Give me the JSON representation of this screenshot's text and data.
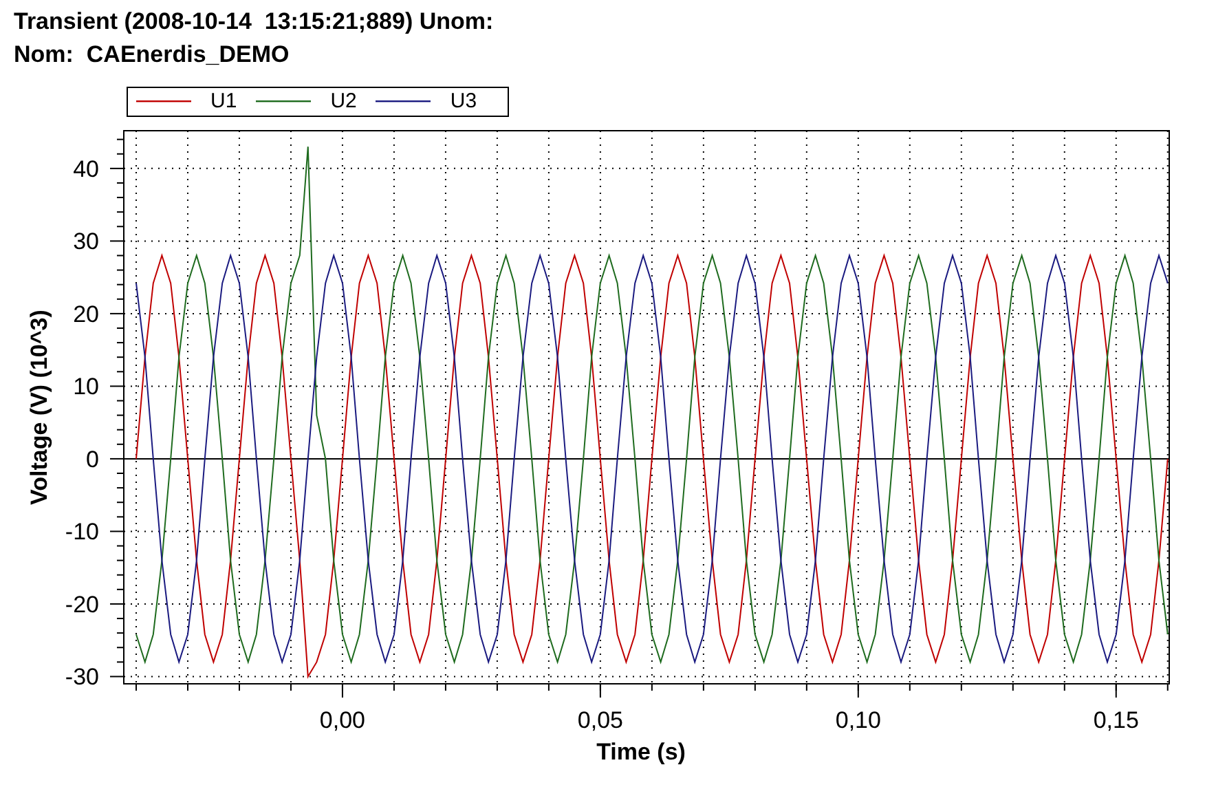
{
  "header": {
    "title": "Transient (2008-10-14  13:15:21;889) Unom:",
    "subtitle": "Nom:  CAEnerdis_DEMO"
  },
  "chart": {
    "chart_data": {
      "type": "line",
      "grid": true,
      "xlabel": "Time (s)",
      "ylabel": "Voltage (V) (10^3)",
      "xlim": [
        -0.0424,
        0.1603
      ],
      "ylim": [
        -31,
        45.2
      ],
      "xticks": [
        {
          "value": 0,
          "label": "0,00"
        },
        {
          "value": 0.05,
          "label": "0,05"
        },
        {
          "value": 0.1,
          "label": "0,10"
        },
        {
          "value": 0.15,
          "label": "0,15"
        }
      ],
      "yticks": [
        -30,
        -20,
        -10,
        0,
        10,
        20,
        30,
        40
      ],
      "x": [
        -0.04,
        -0.0383,
        -0.0367,
        -0.035,
        -0.0333,
        -0.0317,
        -0.03,
        -0.0283,
        -0.0267,
        -0.025,
        -0.0233,
        -0.0217,
        -0.02,
        -0.0183,
        -0.0167,
        -0.015,
        -0.0133,
        -0.0117,
        -0.01,
        -0.0083,
        -0.0067,
        -0.005,
        -0.0033,
        -0.0017,
        0,
        0.0017,
        0.0033,
        0.005,
        0.0067,
        0.0083,
        0.01,
        0.0117,
        0.0133,
        0.015,
        0.0167,
        0.0183,
        0.02,
        0.0217,
        0.0233,
        0.025,
        0.0267,
        0.0283,
        0.03,
        0.0317,
        0.0333,
        0.035,
        0.0367,
        0.0383,
        0.04,
        0.0417,
        0.0433,
        0.045,
        0.0467,
        0.0483,
        0.05,
        0.0517,
        0.0533,
        0.055,
        0.0567,
        0.0583,
        0.06,
        0.0617,
        0.0633,
        0.065,
        0.0667,
        0.0683,
        0.07,
        0.0717,
        0.0733,
        0.075,
        0.0767,
        0.0783,
        0.08,
        0.0817,
        0.0833,
        0.085,
        0.0867,
        0.0883,
        0.09,
        0.0917,
        0.0933,
        0.095,
        0.0967,
        0.0983,
        0.1,
        0.1017,
        0.1033,
        0.105,
        0.1067,
        0.1083,
        0.11,
        0.1117,
        0.1133,
        0.115,
        0.1167,
        0.1183,
        0.12,
        0.1217,
        0.1233,
        0.125,
        0.1267,
        0.1283,
        0.13,
        0.1317,
        0.1333,
        0.135,
        0.1367,
        0.1383,
        0.14,
        0.1417,
        0.1433,
        0.145,
        0.1467,
        0.1483,
        0.15,
        0.1517,
        0.1533,
        0.155,
        0.1567,
        0.1583,
        0.16
      ],
      "series": [
        {
          "name": "U1",
          "color": "#c00000",
          "values": [
            0,
            14,
            24.2,
            28,
            24.2,
            14,
            0,
            -14,
            -24.2,
            -28,
            -24.2,
            -14,
            0,
            14,
            24.2,
            28,
            24.2,
            14,
            0,
            -14,
            -30,
            -28,
            -24.2,
            -14,
            0,
            14,
            24.2,
            28,
            24.2,
            14,
            0,
            -14,
            -24.2,
            -28,
            -24.2,
            -14,
            0,
            14,
            24.2,
            28,
            24.2,
            14,
            0,
            -14,
            -24.2,
            -28,
            -24.2,
            -14,
            0,
            14,
            24.2,
            28,
            24.2,
            14,
            0,
            -14,
            -24.2,
            -28,
            -24.2,
            -14,
            0,
            14,
            24.2,
            28,
            24.2,
            14,
            0,
            -14,
            -24.2,
            -28,
            -24.2,
            -14,
            0,
            14,
            24.2,
            28,
            24.2,
            14,
            0,
            -14,
            -24.2,
            -28,
            -24.2,
            -14,
            0,
            14,
            24.2,
            28,
            24.2,
            14,
            0,
            -14,
            -24.2,
            -28,
            -24.2,
            -14,
            0,
            14,
            24.2,
            28,
            24.2,
            14,
            0,
            -14,
            -24.2,
            -28,
            -24.2,
            -14,
            0,
            14,
            24.2,
            28,
            24.2,
            14,
            0,
            -14,
            -24.2,
            -28,
            -24.2,
            -14,
            0
          ]
        },
        {
          "name": "U2",
          "color": "#1e6b1e",
          "values": [
            -24.2,
            -28,
            -24.2,
            -14,
            0,
            14,
            24.2,
            28,
            24.2,
            14,
            0,
            -14,
            -24.2,
            -28,
            -24.2,
            -14,
            0,
            14,
            24.2,
            28,
            43,
            6,
            0,
            -14,
            -24.2,
            -28,
            -24.2,
            -14,
            0,
            14,
            24.2,
            28,
            24.2,
            14,
            0,
            -14,
            -24.2,
            -28,
            -24.2,
            -14,
            0,
            14,
            24.2,
            28,
            24.2,
            14,
            0,
            -14,
            -24.2,
            -28,
            -24.2,
            -14,
            0,
            14,
            24.2,
            28,
            24.2,
            14,
            0,
            -14,
            -24.2,
            -28,
            -24.2,
            -14,
            0,
            14,
            24.2,
            28,
            24.2,
            14,
            0,
            -14,
            -24.2,
            -28,
            -24.2,
            -14,
            0,
            14,
            24.2,
            28,
            24.2,
            14,
            0,
            -14,
            -24.2,
            -28,
            -24.2,
            -14,
            0,
            14,
            24.2,
            28,
            24.2,
            14,
            0,
            -14,
            -24.2,
            -28,
            -24.2,
            -14,
            0,
            14,
            24.2,
            28,
            24.2,
            14,
            0,
            -14,
            -24.2,
            -28,
            -24.2,
            -14,
            0,
            14,
            24.2,
            28,
            24.2,
            14,
            0,
            -14,
            -24.2
          ]
        },
        {
          "name": "U3",
          "color": "#1a1a80",
          "values": [
            24.2,
            14,
            0,
            -14,
            -24.2,
            -28,
            -24.2,
            -14,
            0,
            14,
            24.2,
            28,
            24.2,
            14,
            0,
            -14,
            -24.2,
            -28,
            -24.2,
            -14,
            0,
            14,
            24.2,
            28,
            24.2,
            14,
            0,
            -14,
            -24.2,
            -28,
            -24.2,
            -14,
            0,
            14,
            24.2,
            28,
            24.2,
            14,
            0,
            -14,
            -24.2,
            -28,
            -24.2,
            -14,
            0,
            14,
            24.2,
            28,
            24.2,
            14,
            0,
            -14,
            -24.2,
            -28,
            -24.2,
            -14,
            0,
            14,
            24.2,
            28,
            24.2,
            14,
            0,
            -14,
            -24.2,
            -28,
            -24.2,
            -14,
            0,
            14,
            24.2,
            28,
            24.2,
            14,
            0,
            -14,
            -24.2,
            -28,
            -24.2,
            -14,
            0,
            14,
            24.2,
            28,
            24.2,
            14,
            0,
            -14,
            -24.2,
            -28,
            -24.2,
            -14,
            0,
            14,
            24.2,
            28,
            24.2,
            14,
            0,
            -14,
            -24.2,
            -28,
            -24.2,
            -14,
            0,
            14,
            24.2,
            28,
            24.2,
            14,
            0,
            -14,
            -24.2,
            -28,
            -24.2,
            -14,
            0,
            14,
            24.2,
            28,
            24.2
          ]
        }
      ]
    }
  }
}
